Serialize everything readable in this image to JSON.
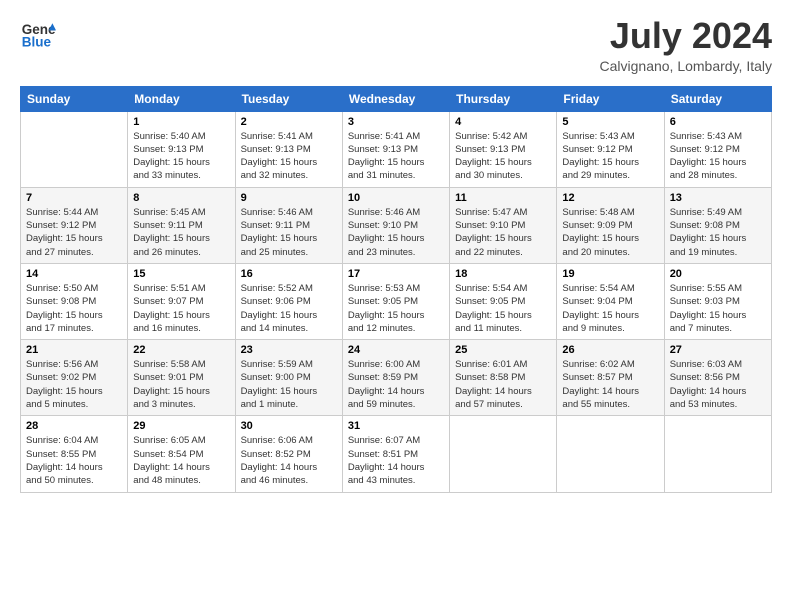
{
  "logo": {
    "line1": "General",
    "line2": "Blue"
  },
  "title": "July 2024",
  "subtitle": "Calvignano, Lombardy, Italy",
  "days_of_week": [
    "Sunday",
    "Monday",
    "Tuesday",
    "Wednesday",
    "Thursday",
    "Friday",
    "Saturday"
  ],
  "weeks": [
    [
      {
        "day": "",
        "info": ""
      },
      {
        "day": "1",
        "info": "Sunrise: 5:40 AM\nSunset: 9:13 PM\nDaylight: 15 hours\nand 33 minutes."
      },
      {
        "day": "2",
        "info": "Sunrise: 5:41 AM\nSunset: 9:13 PM\nDaylight: 15 hours\nand 32 minutes."
      },
      {
        "day": "3",
        "info": "Sunrise: 5:41 AM\nSunset: 9:13 PM\nDaylight: 15 hours\nand 31 minutes."
      },
      {
        "day": "4",
        "info": "Sunrise: 5:42 AM\nSunset: 9:13 PM\nDaylight: 15 hours\nand 30 minutes."
      },
      {
        "day": "5",
        "info": "Sunrise: 5:43 AM\nSunset: 9:12 PM\nDaylight: 15 hours\nand 29 minutes."
      },
      {
        "day": "6",
        "info": "Sunrise: 5:43 AM\nSunset: 9:12 PM\nDaylight: 15 hours\nand 28 minutes."
      }
    ],
    [
      {
        "day": "7",
        "info": "Sunrise: 5:44 AM\nSunset: 9:12 PM\nDaylight: 15 hours\nand 27 minutes."
      },
      {
        "day": "8",
        "info": "Sunrise: 5:45 AM\nSunset: 9:11 PM\nDaylight: 15 hours\nand 26 minutes."
      },
      {
        "day": "9",
        "info": "Sunrise: 5:46 AM\nSunset: 9:11 PM\nDaylight: 15 hours\nand 25 minutes."
      },
      {
        "day": "10",
        "info": "Sunrise: 5:46 AM\nSunset: 9:10 PM\nDaylight: 15 hours\nand 23 minutes."
      },
      {
        "day": "11",
        "info": "Sunrise: 5:47 AM\nSunset: 9:10 PM\nDaylight: 15 hours\nand 22 minutes."
      },
      {
        "day": "12",
        "info": "Sunrise: 5:48 AM\nSunset: 9:09 PM\nDaylight: 15 hours\nand 20 minutes."
      },
      {
        "day": "13",
        "info": "Sunrise: 5:49 AM\nSunset: 9:08 PM\nDaylight: 15 hours\nand 19 minutes."
      }
    ],
    [
      {
        "day": "14",
        "info": "Sunrise: 5:50 AM\nSunset: 9:08 PM\nDaylight: 15 hours\nand 17 minutes."
      },
      {
        "day": "15",
        "info": "Sunrise: 5:51 AM\nSunset: 9:07 PM\nDaylight: 15 hours\nand 16 minutes."
      },
      {
        "day": "16",
        "info": "Sunrise: 5:52 AM\nSunset: 9:06 PM\nDaylight: 15 hours\nand 14 minutes."
      },
      {
        "day": "17",
        "info": "Sunrise: 5:53 AM\nSunset: 9:05 PM\nDaylight: 15 hours\nand 12 minutes."
      },
      {
        "day": "18",
        "info": "Sunrise: 5:54 AM\nSunset: 9:05 PM\nDaylight: 15 hours\nand 11 minutes."
      },
      {
        "day": "19",
        "info": "Sunrise: 5:54 AM\nSunset: 9:04 PM\nDaylight: 15 hours\nand 9 minutes."
      },
      {
        "day": "20",
        "info": "Sunrise: 5:55 AM\nSunset: 9:03 PM\nDaylight: 15 hours\nand 7 minutes."
      }
    ],
    [
      {
        "day": "21",
        "info": "Sunrise: 5:56 AM\nSunset: 9:02 PM\nDaylight: 15 hours\nand 5 minutes."
      },
      {
        "day": "22",
        "info": "Sunrise: 5:58 AM\nSunset: 9:01 PM\nDaylight: 15 hours\nand 3 minutes."
      },
      {
        "day": "23",
        "info": "Sunrise: 5:59 AM\nSunset: 9:00 PM\nDaylight: 15 hours\nand 1 minute."
      },
      {
        "day": "24",
        "info": "Sunrise: 6:00 AM\nSunset: 8:59 PM\nDaylight: 14 hours\nand 59 minutes."
      },
      {
        "day": "25",
        "info": "Sunrise: 6:01 AM\nSunset: 8:58 PM\nDaylight: 14 hours\nand 57 minutes."
      },
      {
        "day": "26",
        "info": "Sunrise: 6:02 AM\nSunset: 8:57 PM\nDaylight: 14 hours\nand 55 minutes."
      },
      {
        "day": "27",
        "info": "Sunrise: 6:03 AM\nSunset: 8:56 PM\nDaylight: 14 hours\nand 53 minutes."
      }
    ],
    [
      {
        "day": "28",
        "info": "Sunrise: 6:04 AM\nSunset: 8:55 PM\nDaylight: 14 hours\nand 50 minutes."
      },
      {
        "day": "29",
        "info": "Sunrise: 6:05 AM\nSunset: 8:54 PM\nDaylight: 14 hours\nand 48 minutes."
      },
      {
        "day": "30",
        "info": "Sunrise: 6:06 AM\nSunset: 8:52 PM\nDaylight: 14 hours\nand 46 minutes."
      },
      {
        "day": "31",
        "info": "Sunrise: 6:07 AM\nSunset: 8:51 PM\nDaylight: 14 hours\nand 43 minutes."
      },
      {
        "day": "",
        "info": ""
      },
      {
        "day": "",
        "info": ""
      },
      {
        "day": "",
        "info": ""
      }
    ]
  ]
}
